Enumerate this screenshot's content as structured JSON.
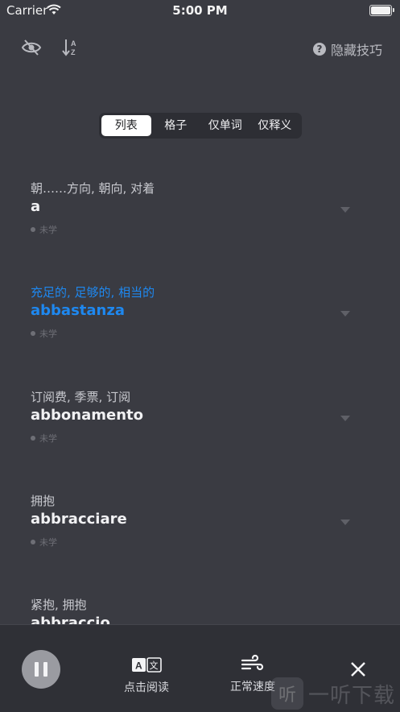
{
  "status_bar": {
    "carrier": "Carrier",
    "time": "5:00 PM"
  },
  "toolbar": {
    "tips_label": "隐藏技巧",
    "tips_icon": "question-circle-icon"
  },
  "segments": [
    {
      "label": "列表",
      "active": true
    },
    {
      "label": "格子",
      "active": false
    },
    {
      "label": "仅单词",
      "active": false
    },
    {
      "label": "仅释义",
      "active": false
    }
  ],
  "items": [
    {
      "meaning": "朝……方向, 朝向, 对着",
      "word": "a",
      "status": "未学"
    },
    {
      "meaning": "充足的, 足够的, 相当的",
      "word": "abbastanza",
      "status": "未学",
      "highlight": true
    },
    {
      "meaning": "订阅费, 季票, 订阅",
      "word": "abbonamento",
      "status": "未学"
    },
    {
      "meaning": "拥抱",
      "word": "abbracciare",
      "status": "未学"
    },
    {
      "meaning": "紧抱, 拥抱",
      "word": "abbraccio",
      "status": ""
    }
  ],
  "controls": {
    "read_label": "点击阅读",
    "speed_label": "正常速度"
  },
  "watermark": {
    "logo": "听",
    "text": "一听下载"
  },
  "colors": {
    "background": "#3a3b42",
    "highlight": "#1e88f0",
    "segment_active": "#ffffff"
  }
}
